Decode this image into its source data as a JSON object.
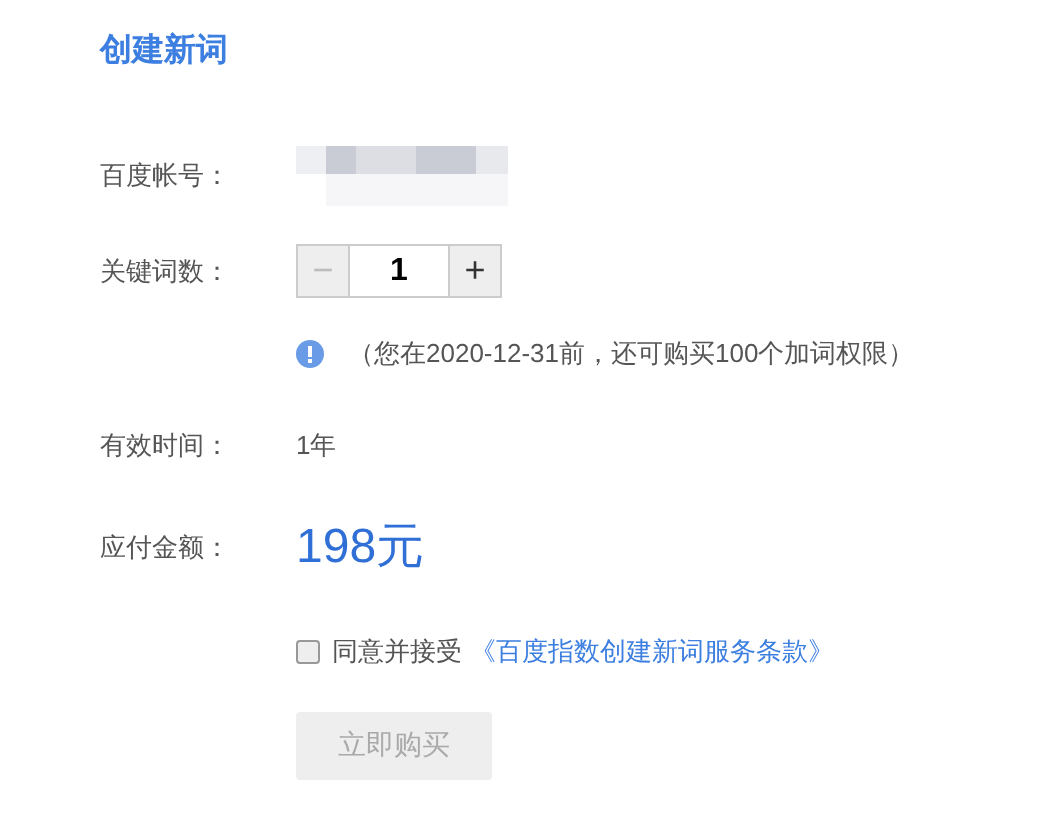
{
  "title": "创建新词",
  "account": {
    "label": "百度帐号："
  },
  "keywords": {
    "label": "关键词数：",
    "value": "1",
    "decrement": {
      "label": "−",
      "disabled": true
    },
    "increment": {
      "label": "+",
      "disabled": false
    }
  },
  "notice": "（您在2020-12-31前，还可购买100个加词权限）",
  "validity": {
    "label": "有效时间：",
    "value": "1年"
  },
  "amount": {
    "label": "应付金额：",
    "value": "198元"
  },
  "agreement": {
    "checked": false,
    "text": "同意并接受",
    "link": "《百度指数创建新词服务条款》"
  },
  "buy_button": {
    "label": "立即购买",
    "disabled": true
  }
}
